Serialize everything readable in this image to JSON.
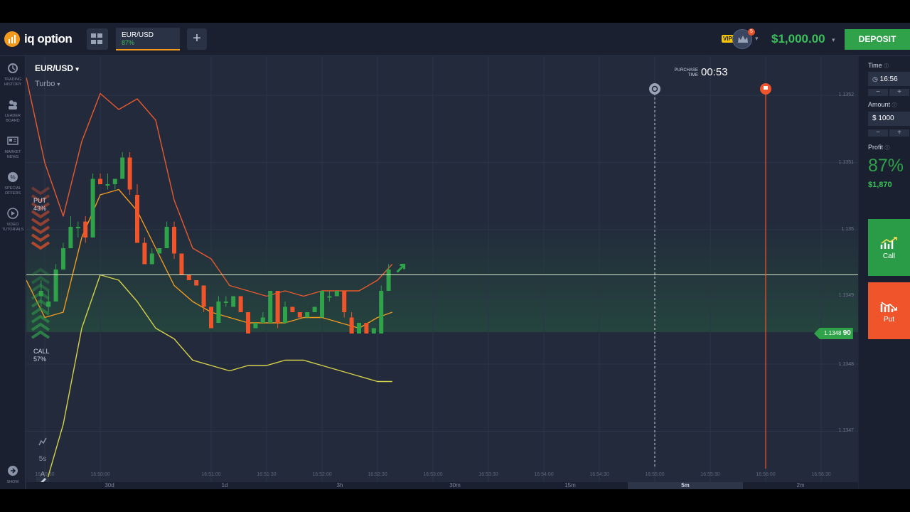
{
  "header": {
    "logo_text": "iq option",
    "asset_tab": {
      "name": "EUR/USD",
      "profit": "87%"
    },
    "add_tab_label": "+",
    "vip_label": "VIP",
    "notification_count": "5",
    "balance": "$1,000.00",
    "deposit_label": "DEPOSIT"
  },
  "sidebar": {
    "items": [
      {
        "label": "TRADING HISTORY",
        "icon": "history-icon"
      },
      {
        "label": "LEADER BOARD",
        "icon": "leaderboard-icon"
      },
      {
        "label": "MARKET NEWS",
        "icon": "news-icon"
      },
      {
        "label": "SPECIAL OFFERS",
        "icon": "offers-icon"
      },
      {
        "label": "VIDEO TUTORIALS",
        "icon": "video-icon"
      }
    ],
    "show_label": "SHOW"
  },
  "chart": {
    "pair": "EUR/USD",
    "mode": "Turbo",
    "purchase_label": "PURCHASE TIME",
    "purchase_time": "00:53",
    "put_label": "PUT",
    "put_pct": "43%",
    "call_label": "CALL",
    "call_pct": "57%",
    "current_price": "1.1348",
    "current_price_suffix": "90",
    "price_axis": [
      "1.1352",
      "1.1351",
      "1.135",
      "1.1349",
      "1.1348",
      "1.1347"
    ],
    "time_axis": [
      "16:49:30",
      "16:50:00",
      "16:51:00",
      "16:51:30",
      "16:52:00",
      "16:52:30",
      "16:53:00",
      "16:53:30",
      "16:54:00",
      "16:54:30",
      "16:55:00",
      "16:55:30",
      "16:56:00",
      "16:56:30"
    ],
    "tools": [
      "chart-type-icon",
      "5s",
      "A",
      "indicators-icon",
      "pencil-icon"
    ],
    "timeframes": [
      "30d",
      "1d",
      "3h",
      "30m",
      "15m",
      "5m",
      "2m"
    ],
    "active_timeframe": "5m",
    "colors": {
      "up": "#2fa24a",
      "down": "#f0542a",
      "bb": "#e8592e",
      "ma": "#f29a1e",
      "lower": "#d6d24a"
    }
  },
  "chart_data": {
    "type": "line",
    "candles": [
      [
        "16:49:28",
        1.13485,
        1.13488,
        1.13483,
        1.13486
      ],
      [
        "16:49:32",
        1.13483,
        1.13486,
        1.13482,
        1.13484
      ],
      [
        "16:49:36",
        1.13484,
        1.13491,
        1.13484,
        1.1349
      ],
      [
        "16:49:40",
        1.1349,
        1.13495,
        1.1349,
        1.13494
      ],
      [
        "16:49:44",
        1.13494,
        1.135,
        1.13494,
        1.13498
      ],
      [
        "16:49:48",
        1.13498,
        1.13499,
        1.13496,
        1.13498
      ],
      [
        "16:49:52",
        1.13499,
        1.135,
        1.13495,
        1.13496
      ],
      [
        "16:49:56",
        1.13496,
        1.13508,
        1.13496,
        1.13507
      ],
      [
        "16:50:00",
        1.13507,
        1.13508,
        1.13506,
        1.13506
      ],
      [
        "16:50:04",
        1.13506,
        1.13508,
        1.13505,
        1.13506
      ],
      [
        "16:50:08",
        1.13506,
        1.13507,
        1.13505,
        1.13507
      ],
      [
        "16:50:12",
        1.13507,
        1.13512,
        1.13507,
        1.13511
      ],
      [
        "16:50:16",
        1.13511,
        1.13512,
        1.13504,
        1.13505
      ],
      [
        "16:50:20",
        1.13504,
        1.13506,
        1.13495,
        1.13495
      ],
      [
        "16:50:24",
        1.13495,
        1.13496,
        1.13491,
        1.13491
      ],
      [
        "16:50:28",
        1.13491,
        1.13494,
        1.13491,
        1.13493
      ],
      [
        "16:50:32",
        1.13493,
        1.13494,
        1.13493,
        1.13494
      ],
      [
        "16:50:36",
        1.13494,
        1.13499,
        1.13494,
        1.13498
      ],
      [
        "16:50:40",
        1.13498,
        1.13499,
        1.13492,
        1.13493
      ],
      [
        "16:50:44",
        1.13493,
        1.13493,
        1.13489,
        1.13489
      ],
      [
        "16:50:48",
        1.13489,
        1.13489,
        1.13488,
        1.13488
      ],
      [
        "16:50:52",
        1.13488,
        1.13488,
        1.13487,
        1.13487
      ],
      [
        "16:50:56",
        1.13487,
        1.13487,
        1.13482,
        1.13483
      ],
      [
        "16:51:00",
        1.13483,
        1.13483,
        1.13479,
        1.13479
      ],
      [
        "16:51:04",
        1.1348,
        1.13485,
        1.1348,
        1.13484
      ],
      [
        "16:51:08",
        1.13484,
        1.13485,
        1.13483,
        1.13484
      ],
      [
        "16:51:12",
        1.13483,
        1.13485,
        1.13483,
        1.13485
      ],
      [
        "16:51:16",
        1.13485,
        1.13485,
        1.13482,
        1.13482
      ],
      [
        "16:51:20",
        1.13482,
        1.13482,
        1.13478,
        1.13478
      ],
      [
        "16:51:24",
        1.13479,
        1.1348,
        1.13479,
        1.1348
      ],
      [
        "16:51:28",
        1.1348,
        1.13482,
        1.1348,
        1.13481
      ],
      [
        "16:51:32",
        1.1348,
        1.13486,
        1.1348,
        1.13486
      ],
      [
        "16:51:36",
        1.13486,
        1.13486,
        1.13479,
        1.1348
      ],
      [
        "16:51:40",
        1.1348,
        1.13484,
        1.1348,
        1.13483
      ],
      [
        "16:51:44",
        1.13483,
        1.13483,
        1.13482,
        1.13482
      ],
      [
        "16:51:48",
        1.13482,
        1.13482,
        1.13481,
        1.13481
      ],
      [
        "16:51:52",
        1.13481,
        1.13482,
        1.13481,
        1.13482
      ],
      [
        "16:51:56",
        1.13482,
        1.13483,
        1.13482,
        1.13483
      ],
      [
        "16:52:00",
        1.13481,
        1.13486,
        1.13481,
        1.13486
      ],
      [
        "16:52:04",
        1.13485,
        1.13486,
        1.13484,
        1.13485
      ],
      [
        "16:52:08",
        1.13485,
        1.13486,
        1.13485,
        1.13486
      ],
      [
        "16:52:12",
        1.13486,
        1.13486,
        1.13481,
        1.13482
      ],
      [
        "16:52:16",
        1.13481,
        1.13482,
        1.13478,
        1.13478
      ],
      [
        "16:52:20",
        1.13478,
        1.1348,
        1.13478,
        1.1348
      ],
      [
        "16:52:24",
        1.1348,
        1.1348,
        1.13478,
        1.13478
      ],
      [
        "16:52:28",
        1.13478,
        1.13479,
        1.13478,
        1.13479
      ],
      [
        "16:52:32",
        1.13478,
        1.13487,
        1.13478,
        1.13486
      ],
      [
        "16:52:36",
        1.13486,
        1.13491,
        1.13486,
        1.1349
      ]
    ],
    "bollinger_upper": [
      [
        "16:49:20",
        1.13526
      ],
      [
        "16:49:30",
        1.1351
      ],
      [
        "16:49:40",
        1.135
      ],
      [
        "16:49:50",
        1.13514
      ],
      [
        "16:50:00",
        1.13523
      ],
      [
        "16:50:10",
        1.1352
      ],
      [
        "16:50:20",
        1.13522
      ],
      [
        "16:50:30",
        1.13518
      ],
      [
        "16:50:40",
        1.13503
      ],
      [
        "16:50:50",
        1.13494
      ],
      [
        "16:51:00",
        1.13492
      ],
      [
        "16:51:10",
        1.13487
      ],
      [
        "16:51:20",
        1.13486
      ],
      [
        "16:51:30",
        1.13485
      ],
      [
        "16:51:40",
        1.13486
      ],
      [
        "16:51:50",
        1.13485
      ],
      [
        "16:52:00",
        1.13486
      ],
      [
        "16:52:10",
        1.13486
      ],
      [
        "16:52:20",
        1.13486
      ],
      [
        "16:52:30",
        1.13488
      ],
      [
        "16:52:38",
        1.13491
      ]
    ],
    "moving_average": [
      [
        "16:49:20",
        1.13488
      ],
      [
        "16:49:30",
        1.13481
      ],
      [
        "16:49:40",
        1.13482
      ],
      [
        "16:49:50",
        1.13496
      ],
      [
        "16:50:00",
        1.13504
      ],
      [
        "16:50:10",
        1.13505
      ],
      [
        "16:50:20",
        1.13501
      ],
      [
        "16:50:30",
        1.13494
      ],
      [
        "16:50:40",
        1.13487
      ],
      [
        "16:50:50",
        1.13484
      ],
      [
        "16:51:00",
        1.13482
      ],
      [
        "16:51:10",
        1.13481
      ],
      [
        "16:51:20",
        1.1348
      ],
      [
        "16:51:30",
        1.1348
      ],
      [
        "16:51:40",
        1.1348
      ],
      [
        "16:51:50",
        1.13481
      ],
      [
        "16:52:00",
        1.13481
      ],
      [
        "16:52:10",
        1.1348
      ],
      [
        "16:52:20",
        1.13479
      ],
      [
        "16:52:30",
        1.13481
      ],
      [
        "16:52:38",
        1.13482
      ]
    ],
    "bollinger_lower": [
      [
        "16:49:30",
        1.13449
      ],
      [
        "16:49:40",
        1.13461
      ],
      [
        "16:49:50",
        1.13479
      ],
      [
        "16:50:00",
        1.13489
      ],
      [
        "16:50:10",
        1.13488
      ],
      [
        "16:50:20",
        1.13484
      ],
      [
        "16:50:30",
        1.13479
      ],
      [
        "16:50:40",
        1.13477
      ],
      [
        "16:50:50",
        1.13473
      ],
      [
        "16:51:00",
        1.13472
      ],
      [
        "16:51:10",
        1.13471
      ],
      [
        "16:51:20",
        1.13472
      ],
      [
        "16:51:30",
        1.13472
      ],
      [
        "16:51:40",
        1.13473
      ],
      [
        "16:51:50",
        1.13473
      ],
      [
        "16:52:00",
        1.13472
      ],
      [
        "16:52:10",
        1.13471
      ],
      [
        "16:52:20",
        1.1347
      ],
      [
        "16:52:30",
        1.13469
      ],
      [
        "16:52:38",
        1.13469
      ]
    ],
    "current_price": 1.13489,
    "purchase_line_time": "16:55:00",
    "expiry_line_time": "16:56:00",
    "ylim": [
      1.1345,
      1.13526
    ],
    "xlim": [
      "16:49:20",
      "16:56:50"
    ],
    "xlabel": "",
    "ylabel": "",
    "grid": true
  },
  "panel": {
    "time_label": "Time",
    "time_value": "16:56",
    "amount_label": "Amount",
    "amount_value": "$ 1000",
    "profit_label": "Profit",
    "profit_pct": "87%",
    "profit_amount": "$1,870",
    "call_label": "Call",
    "put_label": "Put",
    "minus": "−",
    "plus": "+"
  }
}
